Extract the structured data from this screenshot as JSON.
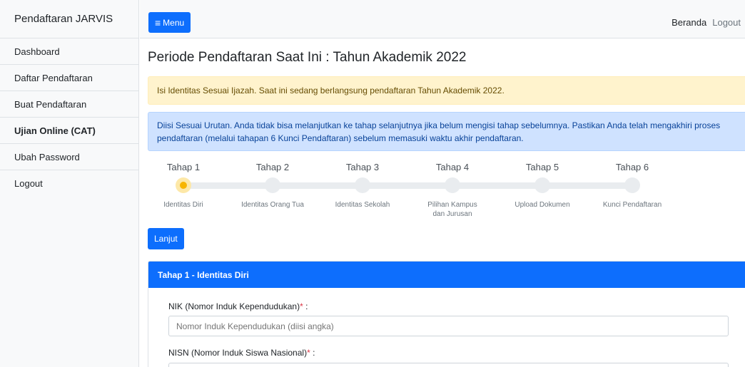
{
  "sidebar": {
    "brand": "Pendaftaran JARVIS",
    "items": [
      {
        "label": "Dashboard"
      },
      {
        "label": "Daftar Pendaftaran"
      },
      {
        "label": "Buat Pendaftaran"
      },
      {
        "label": "Ujian Online (CAT)",
        "active": true
      },
      {
        "label": "Ubah Password"
      },
      {
        "label": "Logout"
      }
    ]
  },
  "navbar": {
    "menu_icon": "bars-icon",
    "menu_icon_glyph": "≡",
    "menu_label": "Menu",
    "links": [
      "Beranda",
      "Logout"
    ]
  },
  "main": {
    "title": "Periode Pendaftaran Saat Ini : Tahun Akademik 2022",
    "alert_warning": "Isi Identitas Sesuai Ijazah. Saat ini sedang berlangsung pendaftaran Tahun Akademik 2022.",
    "alert_info": "Diisi Sesuai Urutan. Anda tidak bisa melanjutkan ke tahap selanjutnya jika belum mengisi tahap sebelumnya. Pastikan Anda telah mengakhiri proses pendaftaran (melalui tahapan 6 Kunci Pendaftaran) sebelum memasuki waktu akhir pendaftaran.",
    "steps": [
      {
        "title": "Tahap 1",
        "desc": "Identitas Diri",
        "active": true
      },
      {
        "title": "Tahap 2",
        "desc": "Identitas Orang Tua"
      },
      {
        "title": "Tahap 3",
        "desc": "Identitas Sekolah"
      },
      {
        "title": "Tahap 4",
        "desc": "Pilihan Kampus dan Jurusan"
      },
      {
        "title": "Tahap 5",
        "desc": "Upload Dokumen"
      },
      {
        "title": "Tahap 6",
        "desc": "Kunci Pendaftaran"
      }
    ],
    "next_button": "Lanjut",
    "card": {
      "header": "Tahap 1 - Identitas Diri",
      "required_mark": "*",
      "fields": [
        {
          "label": "NIK (Nomor Induk Kependudukan)",
          "suffix": " :",
          "placeholder": "Nomor Induk Kependudukan (diisi angka)"
        },
        {
          "label": "NISN (Nomor Induk Siswa Nasional)",
          "suffix": " :",
          "placeholder": ""
        }
      ]
    }
  },
  "colors": {
    "primary": "#0d6efd",
    "warning_bg": "#fff3cd",
    "info_bg": "#cfe2ff",
    "active_step": "#f7b500",
    "required": "#dc3545"
  }
}
